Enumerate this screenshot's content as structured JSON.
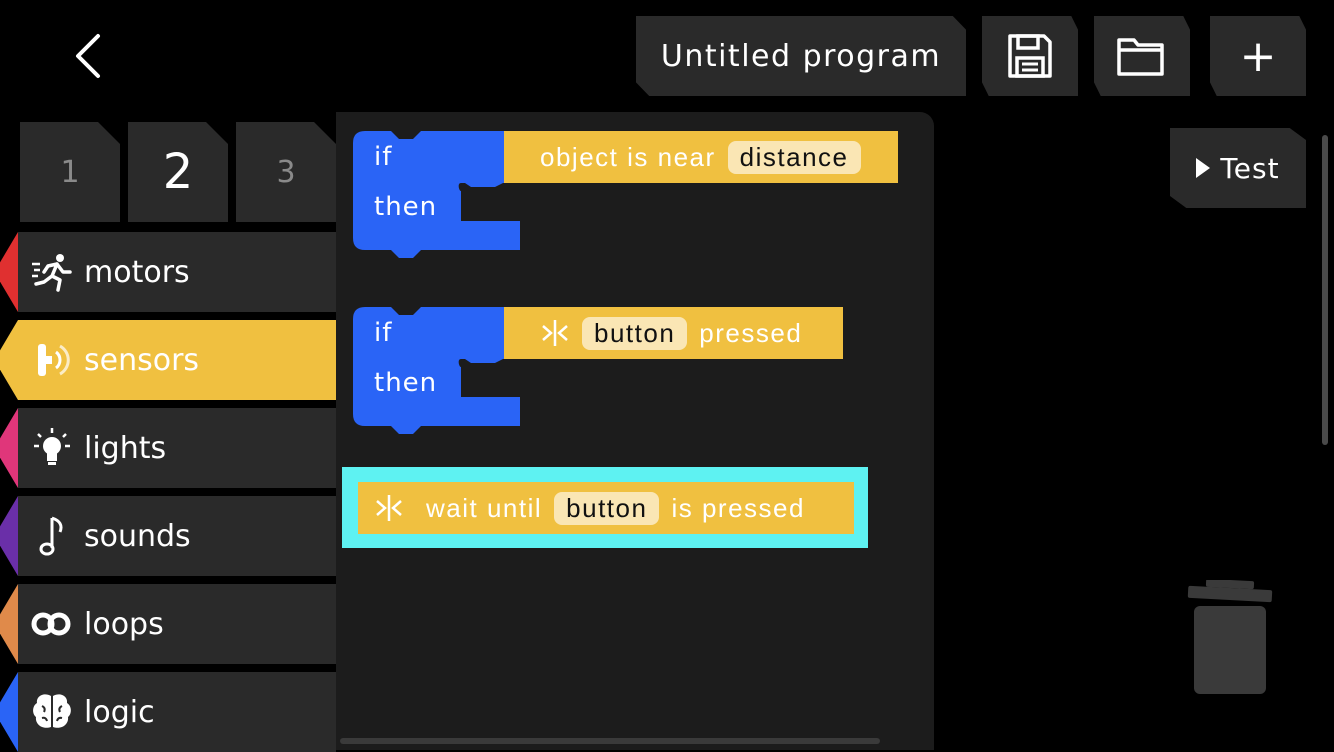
{
  "header": {
    "back_icon": "chevron-left-icon",
    "program_title": "Untitled program",
    "save_icon": "floppy-disk-icon",
    "open_icon": "folder-icon",
    "new_label": "+"
  },
  "page_tabs": [
    {
      "label": "1"
    },
    {
      "label": "2",
      "active": true
    },
    {
      "label": "3"
    }
  ],
  "categories": [
    {
      "label": "motors",
      "icon": "running-person-icon",
      "color": "#e03030"
    },
    {
      "label": "sensors",
      "icon": "proximity-sensor-icon",
      "color": "#f0c040",
      "selected": true
    },
    {
      "label": "lights",
      "icon": "lightbulb-icon",
      "color": "#e0367a"
    },
    {
      "label": "sounds",
      "icon": "music-note-icon",
      "color": "#6a2fa8"
    },
    {
      "label": "loops",
      "icon": "infinity-loop-icon",
      "color": "#e08a4a"
    },
    {
      "label": "logic",
      "icon": "brain-icon",
      "color": "#2a64f6"
    }
  ],
  "blocks": {
    "block1": {
      "if_label": "if",
      "then_label": "then",
      "condition_text": "object is near",
      "condition_value": "distance"
    },
    "block2": {
      "if_label": "if",
      "then_label": "then",
      "condition_value": "button",
      "condition_text": "pressed"
    },
    "block3": {
      "text_before": "wait until",
      "value": "button",
      "text_after": "is pressed"
    }
  },
  "test_button": {
    "label": "Test",
    "icon": "play-triangle-icon"
  },
  "trash_icon": "trash-can-icon",
  "colors": {
    "block_blue": "#2a64f6",
    "sensor_yellow": "#f0c040",
    "highlight_cyan": "#5ef2f2",
    "panel": "#2a2a2a"
  }
}
